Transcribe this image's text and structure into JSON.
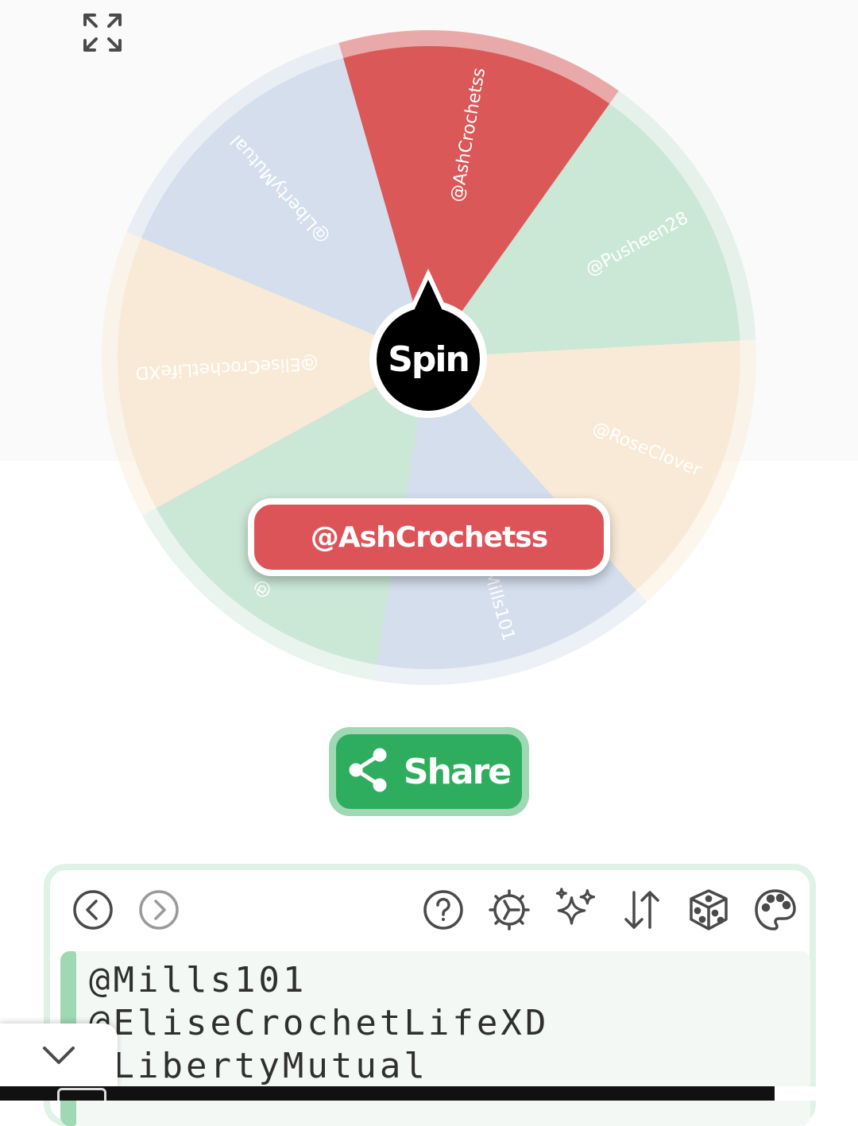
{
  "wheel": {
    "spin_label": "Spin",
    "segments": [
      {
        "label": "@AshCrochetss",
        "color": "#da5858"
      },
      {
        "label": "@Pusheen28",
        "color": "#cbe7d6"
      },
      {
        "label": "@RoseClover",
        "color": "#f8ead6"
      },
      {
        "label": "@Mills101",
        "color": "#d4deed"
      },
      {
        "label": "@",
        "color": "#cbe7d6"
      },
      {
        "label": "@EliseCrochetLifeXD",
        "color": "#f8ead6"
      },
      {
        "label": "@LibertyMutual",
        "color": "#d4deed"
      }
    ]
  },
  "result": {
    "text": "@AshCrochetss",
    "color": "#dc5358"
  },
  "share": {
    "label": "Share"
  },
  "toolbar": {
    "icons": [
      "back-icon",
      "forward-icon",
      "help-icon",
      "settings-icon",
      "sparkles-icon",
      "sort-icon",
      "dice-icon",
      "palette-icon"
    ]
  },
  "editor": {
    "lines": [
      "@Mills101",
      "@EliseCrochetLifeXD",
      "@LibertyMutual"
    ]
  },
  "colors": {
    "accent": "#2fad5f",
    "accent_light": "#9ed9b3",
    "ink": "#4a4a4a"
  }
}
